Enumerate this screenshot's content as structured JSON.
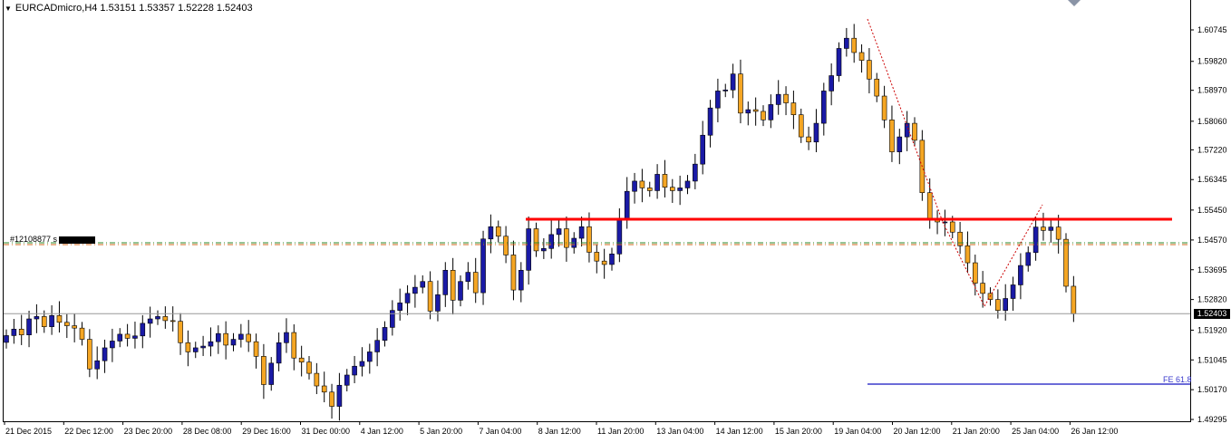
{
  "header": {
    "symbol_info": "EURCADmicro,H4  1.53151 1.53357 1.52228 1.52403",
    "menu_icon": "triangle-down-icon"
  },
  "order_line": {
    "label": "#12108877 s"
  },
  "fe_label": "FE 61.8",
  "current_price": "1.52403",
  "colors": {
    "bull": "#1a1aa6",
    "bear": "#f5a623",
    "resistance": "#ff0000",
    "fe_line": "#3a3acc",
    "order_line_green": "#2e8b2e",
    "order_line_red": "#d2691e"
  },
  "chart_data": {
    "type": "candlestick",
    "symbol": "EURCADmicro",
    "timeframe": "H4",
    "ylim": [
      1.4929,
      1.6175
    ],
    "yticks": [
      1.60745,
      1.5982,
      1.5897,
      1.5806,
      1.5722,
      1.56345,
      1.5545,
      1.5457,
      1.53695,
      1.5282,
      1.5192,
      1.51045,
      1.5017,
      1.49295
    ],
    "ytick_labels": [
      "1.60745",
      "1.59820",
      "1.58970",
      "1.58060",
      "1.57220",
      "1.56345",
      "1.55450",
      "1.54570",
      "1.53695",
      "1.52820",
      "1.51920",
      "1.51045",
      "1.50170",
      "1.49295"
    ],
    "xtick_labels": [
      "21 Dec 2015",
      "22 Dec 12:00",
      "23 Dec 20:00",
      "28 Dec 08:00",
      "29 Dec 16:00",
      "31 Dec 00:00",
      "4 Jan 12:00",
      "5 Jan 20:00",
      "7 Jan 04:00",
      "8 Jan 12:00",
      "11 Jan 20:00",
      "13 Jan 04:00",
      "14 Jan 12:00",
      "15 Jan 20:00",
      "19 Jan 04:00",
      "20 Jan 12:00",
      "21 Jan 20:00",
      "25 Jan 04:00",
      "26 Jan 12:00"
    ],
    "closes": [
      1.5176,
      1.5195,
      1.5178,
      1.5225,
      1.5232,
      1.5202,
      1.5235,
      1.5215,
      1.5205,
      1.5198,
      1.5165,
      1.5078,
      1.5102,
      1.514,
      1.516,
      1.518,
      1.5168,
      1.5175,
      1.5212,
      1.5225,
      1.5232,
      1.522,
      1.5218,
      1.5155,
      1.5128,
      1.514,
      1.5145,
      1.5158,
      1.5182,
      1.5148,
      1.5165,
      1.518,
      1.5158,
      1.5115,
      1.5032,
      1.5095,
      1.5155,
      1.5185,
      1.511,
      1.5098,
      1.5065,
      1.5028,
      1.501,
      1.4968,
      1.503,
      1.506,
      1.5086,
      1.51,
      1.5128,
      1.5162,
      1.52,
      1.525,
      1.5272,
      1.53,
      1.5318,
      1.5335,
      1.5248,
      1.5296,
      1.5368,
      1.528,
      1.5335,
      1.5362,
      1.5302,
      1.546,
      1.5496,
      1.5468,
      1.5413,
      1.531,
      1.5368,
      1.549,
      1.5425,
      1.5432,
      1.5473,
      1.549,
      1.5435,
      1.5462,
      1.5496,
      1.5421,
      1.5395,
      1.5385,
      1.5416,
      1.552,
      1.56,
      1.563,
      1.561,
      1.5602,
      1.565,
      1.5612,
      1.5602,
      1.561,
      1.563,
      1.568,
      1.5765,
      1.5845,
      1.5895,
      1.5898,
      1.5945,
      1.583,
      1.584,
      1.5835,
      1.581,
      1.5855,
      1.5885,
      1.586,
      1.5825,
      1.576,
      1.5745,
      1.58,
      1.5895,
      1.594,
      1.602,
      1.605,
      1.6008,
      1.5985,
      1.593,
      1.588,
      1.581,
      1.5716,
      1.576,
      1.58,
      1.575,
      1.5596,
      1.552,
      1.551,
      1.551,
      1.548,
      1.544,
      1.539,
      1.533,
      1.53,
      1.5282,
      1.525,
      1.5285,
      1.5325,
      1.5382,
      1.542,
      1.5495,
      1.5485,
      1.5495,
      1.5459,
      1.5321,
      1.524
    ]
  }
}
